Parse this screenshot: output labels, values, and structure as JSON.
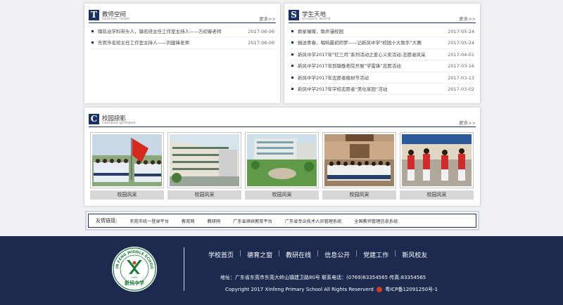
{
  "teacher": {
    "icon": "T",
    "title": "教师空间",
    "sub": "teacher room",
    "more": "更多>>",
    "items": [
      {
        "title": "璞玖治学科带头人，镇名班主任工作室主持人——万初春老师",
        "date": "2017-06-06"
      },
      {
        "title": "东莞市名班主任工作室主持人——刘建锋老师",
        "date": "2017-06-06"
      }
    ]
  },
  "student": {
    "icon": "S",
    "title": "学生天地",
    "sub": "student world",
    "more": "更多>>",
    "items": [
      {
        "title": "群星璀璨，歌声漫校园",
        "date": "2017-05-24"
      },
      {
        "title": "报送青春，唱响最初的梦——记新风中学“校园十大歌手”大赛",
        "date": "2017-05-24"
      },
      {
        "title": "新风中学2017年“红三月”系列活动之爱心义卖活动-志愿者风采",
        "date": "2017-04-01"
      },
      {
        "title": "新风中学2017年到镇敬老院开展“学雷锋”志愿活动",
        "date": "2017-03-16"
      },
      {
        "title": "新风中学2017年志愿者植树节活动",
        "date": "2017-03-13"
      },
      {
        "title": "新风中学2017年学校志愿者“美化家园”活动",
        "date": "2017-03-02"
      }
    ]
  },
  "campus": {
    "icon": "C",
    "title": "校园掠影",
    "sub": "campus glimpse",
    "more": "更多>>",
    "photos": [
      {
        "caption": "校园风采"
      },
      {
        "caption": "校园风采"
      },
      {
        "caption": "校园风采"
      },
      {
        "caption": "校园风采"
      },
      {
        "caption": "校园风采"
      }
    ]
  },
  "links": {
    "label": "友情链接:",
    "items": [
      "东莞市统一登录平台",
      "教育网",
      "教研网",
      "广东省继续教育平台",
      "广东省专业技术人员管理系统",
      "全国教师管理信息系统"
    ]
  },
  "footer": {
    "logo_text": "XIN FENG MIDDLE SCHOOL",
    "logo_cn": "新风中学",
    "logo_year": "1993",
    "nav": [
      "学校首页",
      "德育之窗",
      "教研在线",
      "信息公开",
      "党建工作",
      "新风校友"
    ],
    "address": "地址：广东省东莞市东莞大岭山镇建卫路80号 联系电话：(0769)83354565 传真:83354565",
    "copyright": "Copyright 2017 Xinfeng Primary School All Rights Reserverd",
    "icp": "粤ICP备12091250号-1"
  },
  "colors": {
    "navy": "#1d2a4f",
    "accent": "#1b2f63"
  }
}
